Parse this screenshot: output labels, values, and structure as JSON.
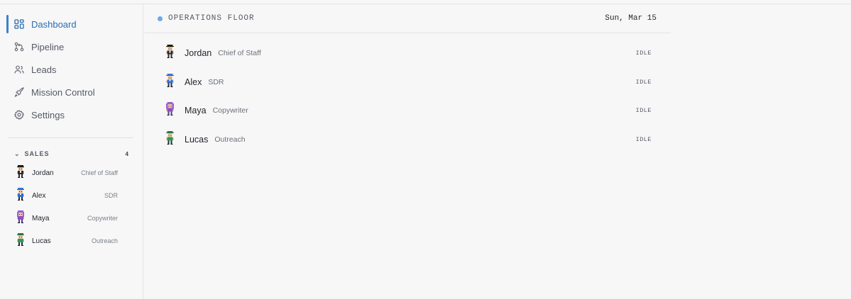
{
  "sidebar": {
    "nav": [
      {
        "label": "Dashboard",
        "icon": "grid-icon",
        "active": true
      },
      {
        "label": "Pipeline",
        "icon": "git-branch-icon",
        "active": false
      },
      {
        "label": "Leads",
        "icon": "users-icon",
        "active": false
      },
      {
        "label": "Mission Control",
        "icon": "rocket-icon",
        "active": false
      },
      {
        "label": "Settings",
        "icon": "gear-icon",
        "active": false
      }
    ],
    "group": {
      "label": "SALES",
      "count": "4",
      "expanded": true
    },
    "agents": [
      {
        "name": "Jordan",
        "role": "Chief of Staff"
      },
      {
        "name": "Alex",
        "role": "SDR"
      },
      {
        "name": "Maya",
        "role": "Copywriter"
      },
      {
        "name": "Lucas",
        "role": "Outreach"
      }
    ]
  },
  "main": {
    "title": "OPERATIONS FLOOR",
    "date": "Sun, Mar 15",
    "agents": [
      {
        "name": "Jordan",
        "role": "Chief of Staff",
        "status": "IDLE"
      },
      {
        "name": "Alex",
        "role": "SDR",
        "status": "IDLE"
      },
      {
        "name": "Maya",
        "role": "Copywriter",
        "status": "IDLE"
      },
      {
        "name": "Lucas",
        "role": "Outreach",
        "status": "IDLE"
      }
    ]
  },
  "colors": {
    "accent": "#3b82c4",
    "status_dot": "#6ea7e6",
    "jordan": "#2b2b2b",
    "alex": "#2f6fd0",
    "maya": "#8b4fc7",
    "lucas": "#2e9a55"
  }
}
